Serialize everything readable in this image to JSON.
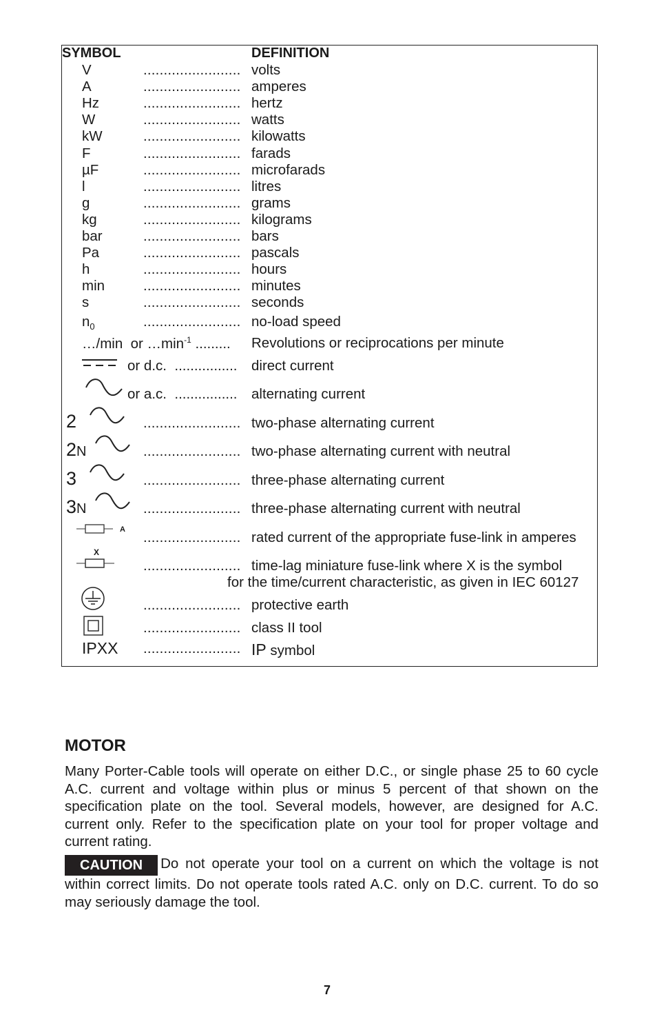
{
  "table": {
    "header_symbol": "SYMBOL",
    "header_definition": "DEFINITION",
    "dots": "........................",
    "dots_short_a": ".........",
    "dots_short_b": "................",
    "rows": [
      {
        "symbol": "V",
        "definition": "volts"
      },
      {
        "symbol": "A",
        "definition": "amperes"
      },
      {
        "symbol": "Hz",
        "definition": "hertz"
      },
      {
        "symbol": "W",
        "definition": "watts"
      },
      {
        "symbol": "kW",
        "definition": "kilowatts"
      },
      {
        "symbol": "F",
        "definition": "farads"
      },
      {
        "symbol": "µF",
        "definition": "microfarads"
      },
      {
        "symbol": "l",
        "definition": "litres"
      },
      {
        "symbol": "g",
        "definition": "grams"
      },
      {
        "symbol": "kg",
        "definition": "kilograms"
      },
      {
        "symbol": "bar",
        "definition": "bars"
      },
      {
        "symbol": "Pa",
        "definition": "pascals"
      },
      {
        "symbol": "h",
        "definition": "hours"
      },
      {
        "symbol": "min",
        "definition": "minutes"
      },
      {
        "symbol": "s",
        "definition": "seconds"
      }
    ],
    "noload": {
      "symbol": "n",
      "subscript": "0",
      "definition": "no-load speed"
    },
    "rpm": {
      "symbol": "…/min  or …min",
      "superscript": "-1",
      "definition": "Revolutions or reciprocations per minute"
    },
    "dc": {
      "icon": "direct-current-icon",
      "symbol": "or d.c.",
      "definition": "direct current"
    },
    "ac": {
      "icon": "alternating-current-icon",
      "symbol": "or a.c.",
      "definition": "alternating current"
    },
    "two_phase": {
      "prefix": "2",
      "suffix": "",
      "definition": "two-phase alternating current"
    },
    "two_phase_n": {
      "prefix": "2",
      "suffix": "N",
      "definition": "two-phase alternating current with neutral"
    },
    "three_phase": {
      "prefix": "3",
      "suffix": "",
      "definition": "three-phase alternating current"
    },
    "three_phase_n": {
      "prefix": "3",
      "suffix": "N",
      "definition": "three-phase alternating current with neutral"
    },
    "fuse": {
      "icon": "fuse-link-icon",
      "label": "A",
      "definition": "rated current of the appropriate fuse-link in amperes"
    },
    "timelag": {
      "icon": "time-lag-fuse-icon",
      "label": "X",
      "definition": "time-lag miniature fuse-link where X is the symbol",
      "definition_cont": "for the time/current characteristic, as given in IEC 60127"
    },
    "earth": {
      "icon": "protective-earth-icon",
      "definition": "protective earth"
    },
    "class2": {
      "icon": "class-ii-tool-icon",
      "definition": "class II tool"
    },
    "ip": {
      "symbol": "IPXX",
      "definition_prefix": "IP",
      "definition": " symbol"
    }
  },
  "motor": {
    "title": "MOTOR",
    "paragraph": "Many Porter-Cable tools will operate on either D.C., or single phase 25 to 60 cycle A.C. current and voltage within plus or minus 5 percent of that shown on the specification plate on the tool. Several models, however, are designed for A.C. current only. Refer to the specification plate on your tool for proper voltage and current rating.",
    "caution_label": "CAUTION",
    "caution_text": "Do not operate your tool on a current on which the voltage is not within correct limits. Do not operate tools rated A.C. only on D.C. current. To do so may seriously damage the tool."
  },
  "page_number": "7"
}
